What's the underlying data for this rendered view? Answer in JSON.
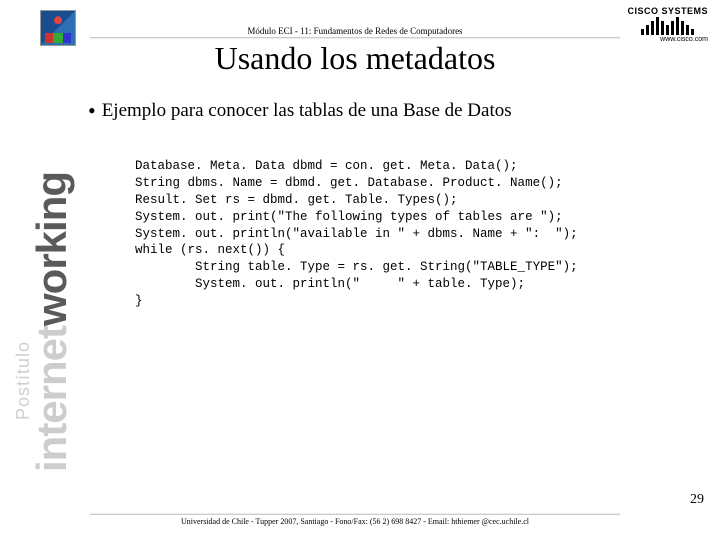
{
  "header": {
    "module_line": "Módulo ECI - 11: Fundamentos de Redes de Computadores",
    "title": "Usando los metadatos"
  },
  "cisco": {
    "brand": "CISCO SYSTEMS",
    "url": "www.cisco.com"
  },
  "bullet": {
    "text": "Ejemplo para conocer las tablas de una Base de Datos"
  },
  "code": "Database. Meta. Data dbmd = con. get. Meta. Data();\nString dbms. Name = dbmd. get. Database. Product. Name();\nResult. Set rs = dbmd. get. Table. Types();\nSystem. out. print(\"The following types of tables are \");\nSystem. out. println(\"available in \" + dbms. Name + \":  \");\nwhile (rs. next()) {\n        String table. Type = rs. get. String(\"TABLE_TYPE\");\n        System. out. println(\"     \" + table. Type);\n}",
  "side": {
    "postitulo": "Postítulo",
    "internet_light": "internet",
    "internet_dark": "working"
  },
  "page_number": "29",
  "footer": "Universidad de Chile - Tupper 2007, Santiago - Fono/Fax: (56 2) 698 8427 - Email: hthiemer @cec.uchile.cl"
}
